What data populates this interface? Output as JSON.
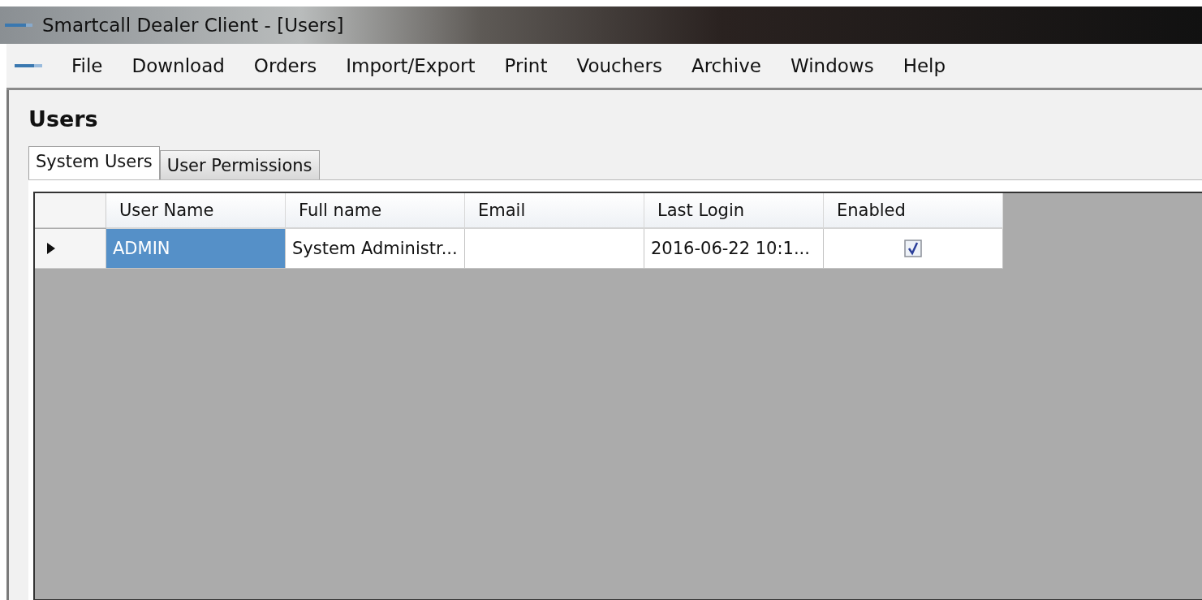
{
  "window": {
    "title": "Smartcall Dealer Client - [Users]"
  },
  "menu": [
    "File",
    "Download",
    "Orders",
    "Import/Export",
    "Print",
    "Vouchers",
    "Archive",
    "Windows",
    "Help"
  ],
  "heading": "Users",
  "tabs": [
    {
      "label": "System Users",
      "selected": true
    },
    {
      "label": "User Permissions",
      "selected": false
    }
  ],
  "table": {
    "columns": [
      "User Name",
      "Full name",
      "Email",
      "Last Login",
      "Enabled"
    ],
    "rows": [
      {
        "current": true,
        "cells": [
          {
            "kind": "text",
            "text": "ADMIN",
            "selected": true
          },
          {
            "kind": "text",
            "text": "System Administr...",
            "selected": false
          },
          {
            "kind": "text",
            "text": "",
            "selected": false
          },
          {
            "kind": "text",
            "text": "2016-06-22 10:1...",
            "selected": false
          },
          {
            "kind": "check",
            "checked": true,
            "selected": false
          }
        ]
      }
    ]
  }
}
